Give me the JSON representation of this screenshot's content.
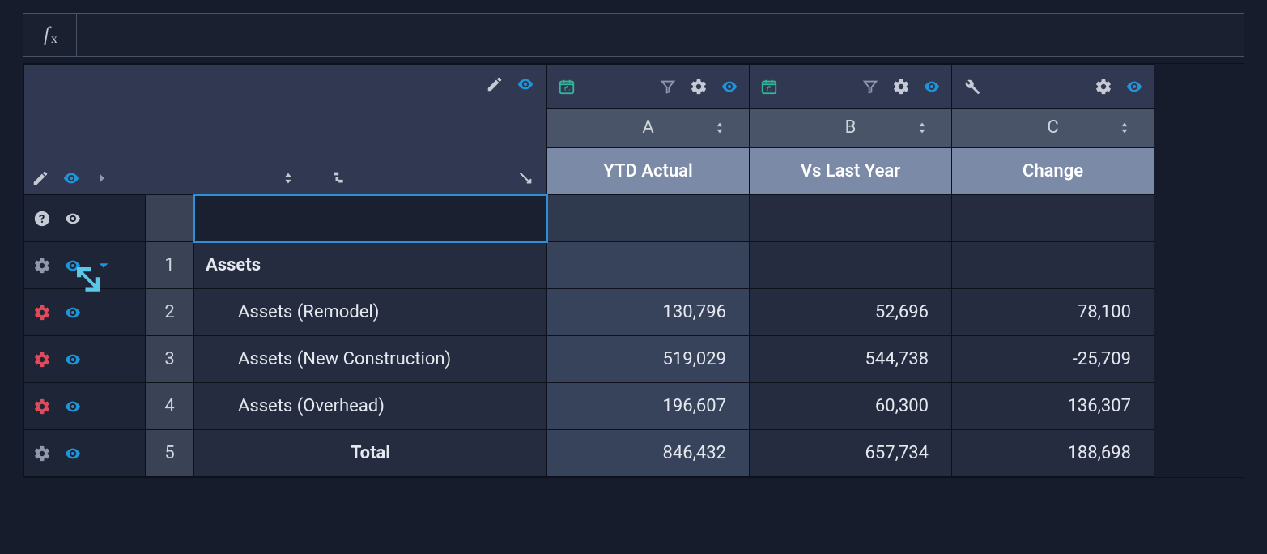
{
  "formula": "",
  "columns": [
    {
      "letter": "A",
      "header": "YTD Actual"
    },
    {
      "letter": "B",
      "header": "Vs Last Year"
    },
    {
      "letter": "C",
      "header": "Change"
    }
  ],
  "rows": [
    {
      "num": "",
      "label": "",
      "values": [
        "",
        "",
        ""
      ],
      "kind": "blank"
    },
    {
      "num": "1",
      "label": "Assets",
      "values": [
        "",
        "",
        ""
      ],
      "kind": "group"
    },
    {
      "num": "2",
      "label": "Assets (Remodel)",
      "values": [
        "130,796",
        "52,696",
        "78,100"
      ],
      "kind": "item"
    },
    {
      "num": "3",
      "label": "Assets (New Construction)",
      "values": [
        "519,029",
        "544,738",
        "-25,709"
      ],
      "kind": "item"
    },
    {
      "num": "4",
      "label": "Assets (Overhead)",
      "values": [
        "196,607",
        "60,300",
        "136,307"
      ],
      "kind": "item"
    },
    {
      "num": "5",
      "label": "Total",
      "values": [
        "846,432",
        "657,734",
        "188,698"
      ],
      "kind": "total"
    }
  ],
  "chart_data": {
    "type": "table",
    "title": "Assets",
    "columns": [
      "YTD Actual",
      "Vs Last Year",
      "Change"
    ],
    "rows": [
      {
        "label": "Assets (Remodel)",
        "values": [
          130796,
          52696,
          78100
        ]
      },
      {
        "label": "Assets (New Construction)",
        "values": [
          519029,
          544738,
          -25709
        ]
      },
      {
        "label": "Assets (Overhead)",
        "values": [
          196607,
          60300,
          136307
        ]
      },
      {
        "label": "Total",
        "values": [
          846432,
          657734,
          188698
        ]
      }
    ]
  }
}
